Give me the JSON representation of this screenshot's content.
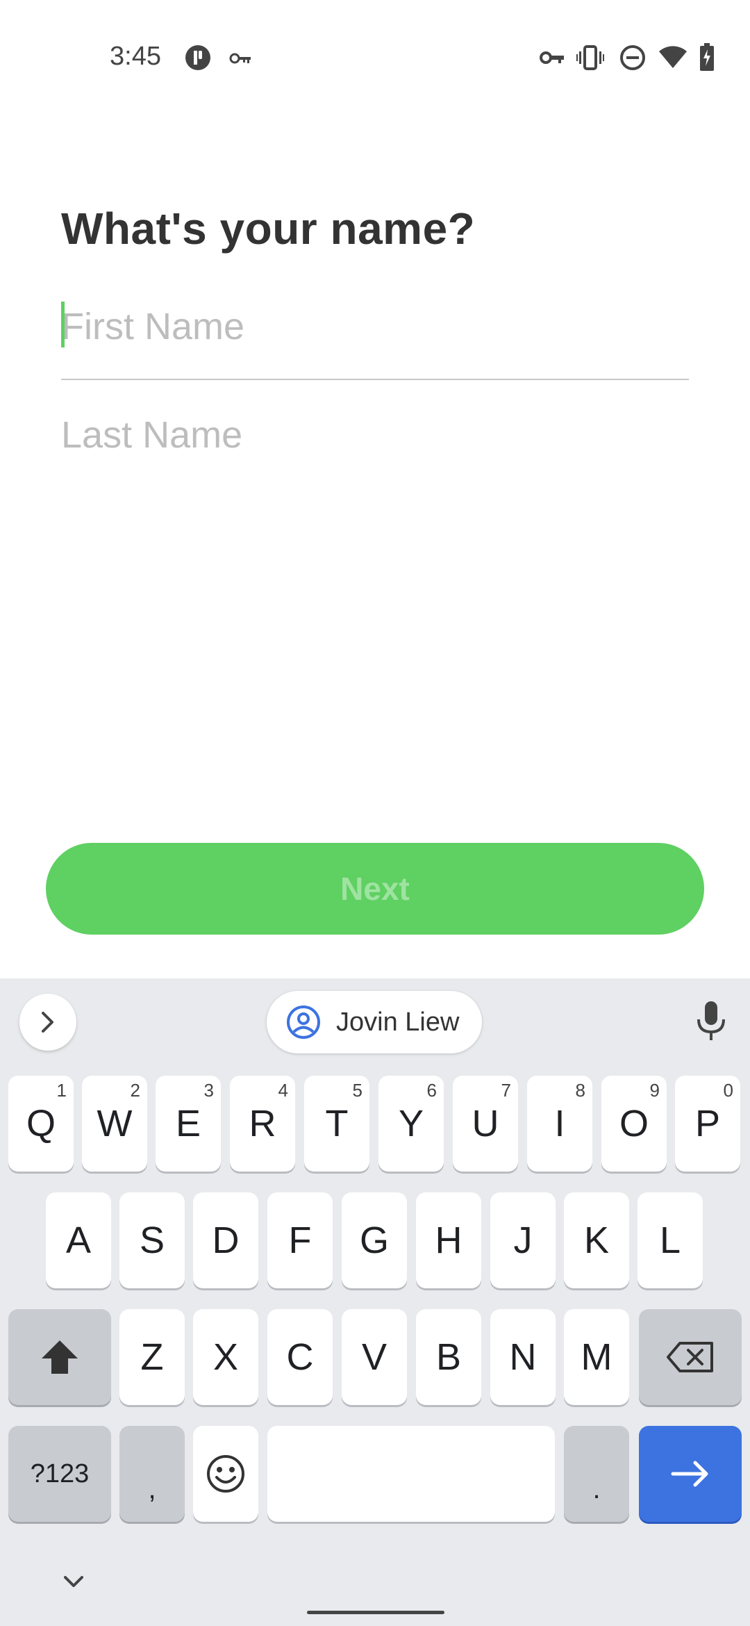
{
  "status_bar": {
    "time": "3:45",
    "left_icons": [
      "app-notification-icon",
      "key-icon"
    ],
    "right_icons": [
      "vpn-key-icon",
      "vibrate-icon",
      "do-not-disturb-icon",
      "wifi-icon",
      "battery-charging-icon"
    ]
  },
  "form": {
    "title": "What's your name?",
    "first_name": {
      "value": "",
      "placeholder": "First Name"
    },
    "last_name": {
      "value": "",
      "placeholder": "Last Name"
    },
    "next_label": "Next"
  },
  "colors": {
    "accent_green": "#5fd062",
    "next_text": "#9fe3a1",
    "enter_blue": "#3d73e0"
  },
  "keyboard": {
    "suggestion": "Jovin Liew",
    "row1": [
      {
        "label": "Q",
        "hint": "1"
      },
      {
        "label": "W",
        "hint": "2"
      },
      {
        "label": "E",
        "hint": "3"
      },
      {
        "label": "R",
        "hint": "4"
      },
      {
        "label": "T",
        "hint": "5"
      },
      {
        "label": "Y",
        "hint": "6"
      },
      {
        "label": "U",
        "hint": "7"
      },
      {
        "label": "I",
        "hint": "8"
      },
      {
        "label": "O",
        "hint": "9"
      },
      {
        "label": "P",
        "hint": "0"
      }
    ],
    "row2": [
      "A",
      "S",
      "D",
      "F",
      "G",
      "H",
      "J",
      "K",
      "L"
    ],
    "row3": [
      "Z",
      "X",
      "C",
      "V",
      "B",
      "N",
      "M"
    ],
    "symbols_label": "?123",
    "comma_label": ",",
    "period_label": "."
  }
}
